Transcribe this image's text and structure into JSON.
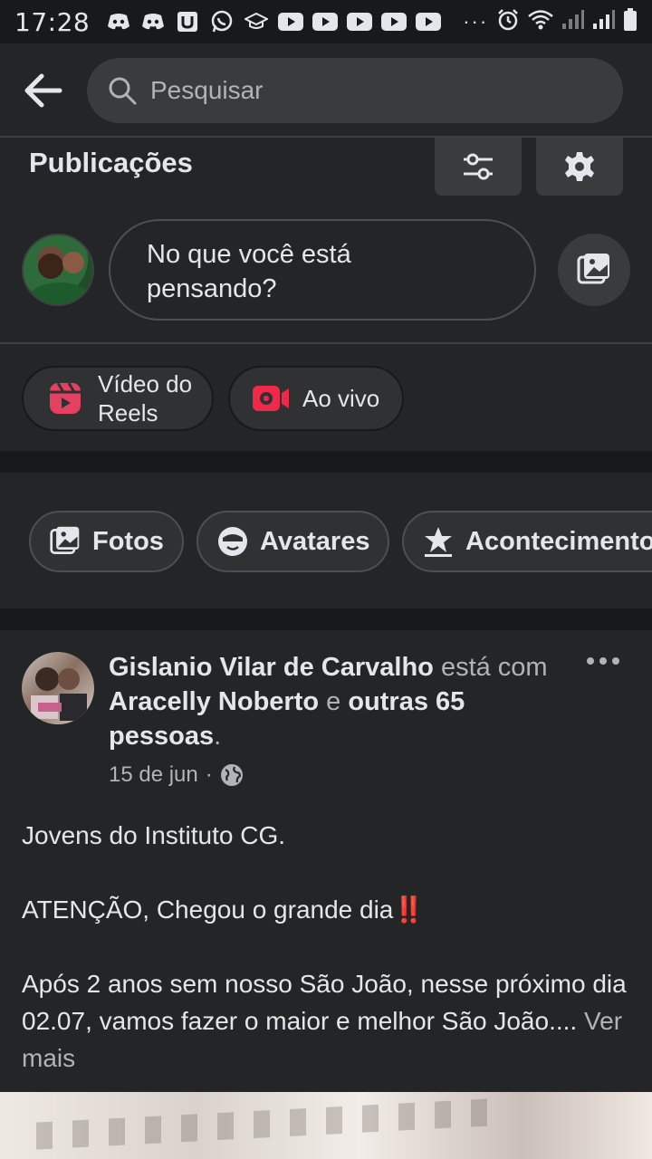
{
  "status_bar": {
    "time": "17:28",
    "dots": "···"
  },
  "search": {
    "placeholder": "Pesquisar"
  },
  "posts_section": {
    "title": "Publicações",
    "composer_prompt_line1": "No que você está",
    "composer_prompt_line2": "pensando?"
  },
  "quick_actions": {
    "reels_line1": "Vídeo do",
    "reels_line2": "Reels",
    "live": "Ao vivo"
  },
  "chips": {
    "photos": "Fotos",
    "avatars": "Avatares",
    "events": "Acontecimentos"
  },
  "post": {
    "author": "Gislanio Vilar de Carvalho",
    "with_text": "está com",
    "tagged": "Aracelly Noberto",
    "and_text": "e",
    "others": "outras 65 pessoas",
    "period": ".",
    "date": "15 de jun",
    "separator": "·",
    "paragraph1": "Jovens do Instituto CG.",
    "paragraph2": "ATENÇÃO, Chegou o grande dia",
    "paragraph2_emoji": "‼️",
    "paragraph3": "Após 2 anos sem nosso São João, nesse próximo dia 02.07, vamos fazer o maior e melhor São João....",
    "see_more": "Ver mais"
  },
  "colors": {
    "background": "#242527",
    "surface": "#3a3b3c",
    "text": "#e4e6eb",
    "muted": "#b0b3b8",
    "reels_pink": "#e4405f",
    "live_red": "#f02849"
  }
}
